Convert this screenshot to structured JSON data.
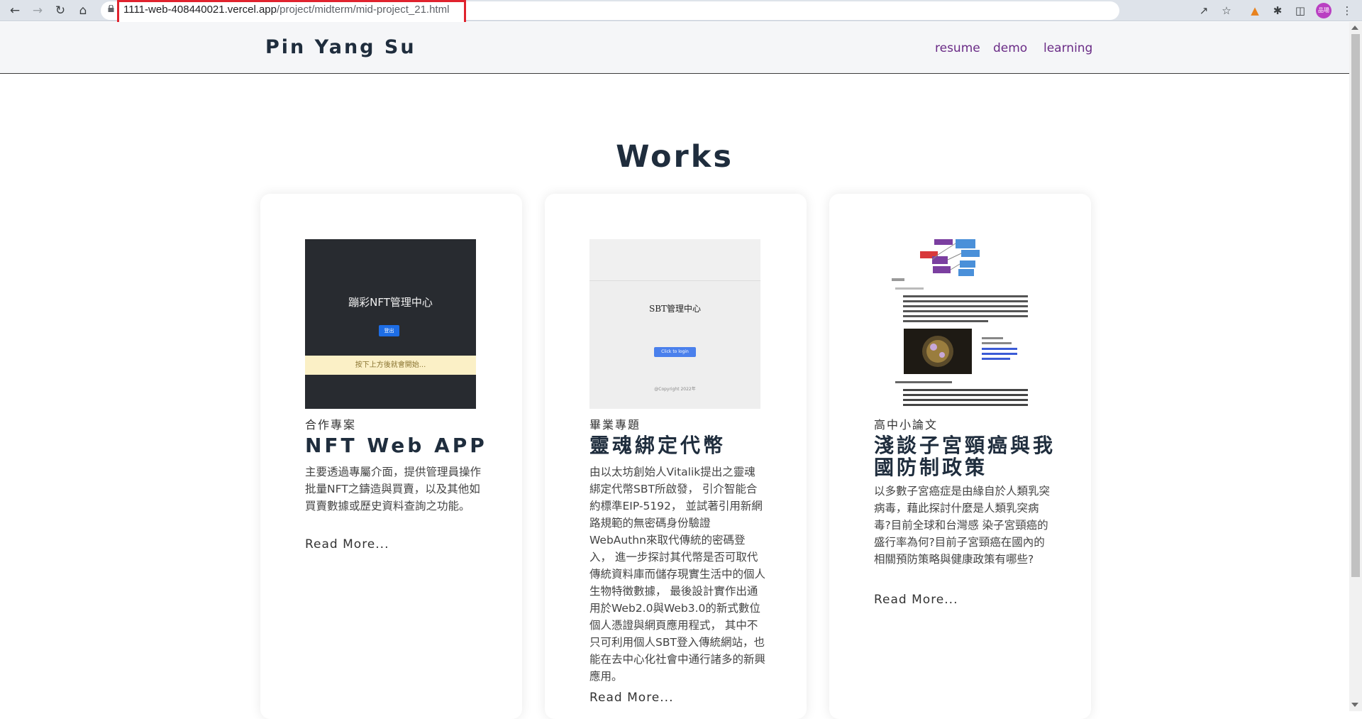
{
  "browser": {
    "url_domain": "1111-web-408440021.vercel.app",
    "url_path": "/project/midterm/mid-project_21.html",
    "profile_initials": "品瑒"
  },
  "header": {
    "brand": "Pin Yang Su",
    "nav": [
      "resume",
      "demo",
      "learning"
    ]
  },
  "works": {
    "title": "Works",
    "cards": [
      {
        "category": "合作專案",
        "title": "NFT Web APP",
        "description": "主要透過專屬介面，提供管理員操作批量NFT之鑄造與買賣，以及其他如買賣數據或歷史資料查詢之功能。",
        "more": "Read More...",
        "thumb": {
          "title": "蹦彩NFT管理中心",
          "button": "登出",
          "note": "按下上方後就會開始..."
        }
      },
      {
        "category": "畢業專題",
        "title": "靈魂綁定代幣",
        "description": "由以太坊創始人Vitalik提出之靈魂綁定代幣SBT所啟發， 引介智能合約標準EIP-5192， 並試著引用新網路規範的無密碼身份驗證WebAuthn來取代傳統的密碼登入， 進一步探討其代幣是否可取代傳統資料庫而儲存現實生活中的個人生物特徵數據， 最後設計實作出通用於Web2.0與Web3.0的新式數位個人憑證與網頁應用程式， 其中不只可利用個人SBT登入傳統網站，也能在去中心化社會中通行諸多的新興應用。",
        "more": "Read More...",
        "thumb": {
          "title": "SBT管理中心",
          "button": "Click to login",
          "footer": "@Copyright 2022年"
        }
      },
      {
        "category": "高中小論文",
        "title": "淺談子宮頸癌與我國防制政策",
        "description": "以多數子宮癌症是由緣自於人類乳突病毒，藉此探討什麼是人類乳突病毒?目前全球和台灣感 染子宮頸癌的盛行率為何?目前子宮頸癌在國內的相關預防策略與健康政策有哪些?",
        "more": "Read More..."
      }
    ]
  },
  "colors": {
    "brand": "#1f2d3d",
    "nav_link": "#6a2b86",
    "url_highlight": "#e0232e"
  }
}
